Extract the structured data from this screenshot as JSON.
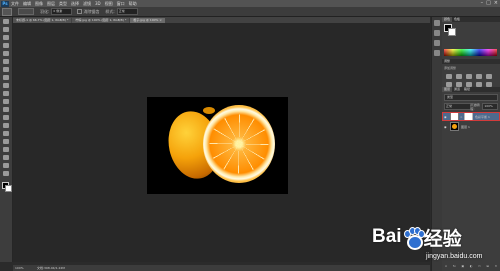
{
  "app": {
    "logo": "Ps"
  },
  "menu": {
    "items": [
      "文件",
      "编辑",
      "图像",
      "图层",
      "类型",
      "选择",
      "滤镜",
      "3D",
      "视图",
      "窗口",
      "帮助"
    ]
  },
  "window_controls": {
    "minimize": "–",
    "maximize": "□",
    "close": "×"
  },
  "options_bar": {
    "feather_label": "羽化:",
    "feather_value": "0 像素",
    "antialias_label": "消除锯齿",
    "style_label": "样式:",
    "style_value": "正常"
  },
  "tabs": [
    {
      "label": "未标题-1 @ 66.7% (图层 1, RGB/8) *"
    },
    {
      "label": "柠檬.jpg @ 100% (图层 1, RGB/8) *"
    },
    {
      "label": "橙子.jpg @ 100% ×"
    }
  ],
  "status": {
    "zoom": "100%",
    "doc": "文档:398.4K/1.22M"
  },
  "color_panel": {
    "tabs": [
      "颜色",
      "色板"
    ],
    "active": "颜色"
  },
  "adjustments_panel": {
    "header": "调整",
    "title": "添加调整"
  },
  "layers_panel": {
    "tabs": [
      "图层",
      "通道",
      "路径"
    ],
    "active": "图层",
    "filter": "类型",
    "blend_mode": "正常",
    "opacity_label": "不透明度:",
    "opacity": "100%",
    "layers": [
      {
        "name": "色彩平衡 1",
        "selected": true
      },
      {
        "name": "图层 1",
        "selected": false
      }
    ],
    "bottom_icons": [
      "link-icon",
      "fx-icon",
      "mask-icon",
      "adjustment-icon",
      "folder-icon",
      "new-layer-icon",
      "trash-icon"
    ]
  },
  "watermark": {
    "brand": "Bai",
    "brand_suffix": "经验",
    "url": "jingyan.baidu.com"
  },
  "colors": {
    "accent_selected": "#4e6a8e",
    "selection_outline": "#d23b3b",
    "workspace": "#282828"
  }
}
